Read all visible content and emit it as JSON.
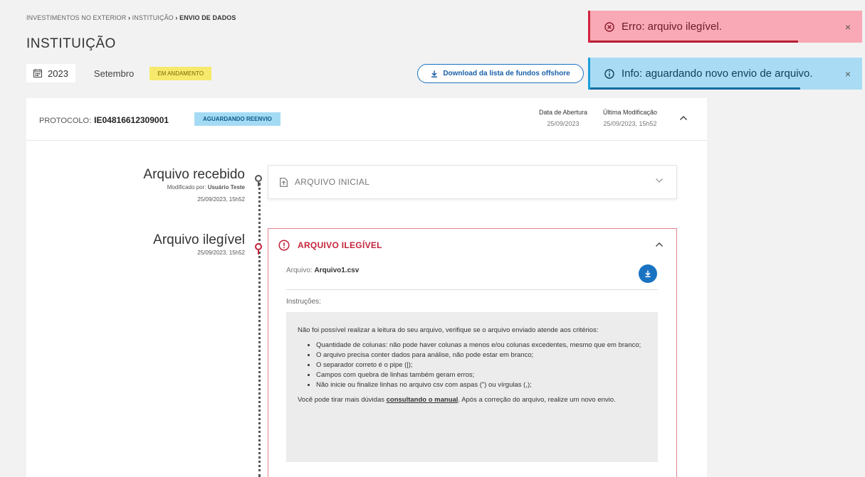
{
  "breadcrumb": {
    "part1": "INVESTIMENTOS NO EXTERIOR",
    "sep1": " › ",
    "part2": "INSTITUIÇÃO",
    "sep2": " › ",
    "part3": "ENVIO DE DADOS"
  },
  "page_title": "INSTITUIÇÃO",
  "meta": {
    "year": "2023",
    "month": "Setembro",
    "status": "EM ANDAMENTO"
  },
  "download_button": "Download da lista de fundos offshore",
  "toasts": {
    "error": {
      "text": "Erro: arquivo ilegível.",
      "close": "×"
    },
    "info": {
      "text": "Info: aguardando novo envio de arquivo.",
      "close": "×"
    }
  },
  "protocol": {
    "label": "PROTOCOLO:",
    "value": "IE04816612309001",
    "status": "AGUARDANDO REENVIO",
    "opening_label": "Data de Abertura",
    "opening_value": "25/09/2023",
    "modified_label": "Última Modificação",
    "modified_value": "25/09/2023, 15h52"
  },
  "timeline": [
    {
      "title": "Arquivo recebido",
      "modified_by_label": "Modificado por:",
      "modified_by": "Usuário Teste",
      "date": "25/09/2023, 15h52",
      "panel_title": "ARQUIVO INICIAL"
    },
    {
      "title": "Arquivo ilegível",
      "date": "25/09/2023, 15h52",
      "panel_title": "ARQUIVO ILEGÍVEL",
      "file_label": "Arquivo:",
      "file_name": "Arquivo1.csv",
      "instructions_label": "Instruções:",
      "intro": "Não foi possível realizar a leitura do seu arquivo, verifique se o arquivo enviado atende aos critérios:",
      "criteria": [
        "Quantidade de colunas: não pode haver colunas a menos e/ou colunas excedentes, mesmo que em branco;",
        "O arquivo precisa conter dados para análise, não pode estar em branco;",
        "O separador correto é o pipe (|);",
        "Campos com quebra de linhas também geram erros;",
        "Não inicie ou finalize linhas no arquivo csv com aspas (\") ou vírgulas (,);"
      ],
      "footer_before": "Você pode tirar mais dúvidas ",
      "footer_link": "consultando o manual",
      "footer_after": ". Após a correção do arquivo, realize um novo envio."
    }
  ],
  "colors": {
    "error": "#c3233b",
    "info": "#1aa0db",
    "primary": "#1a73c1",
    "warning_badge": "#f6e96b"
  },
  "icons": [
    "calendar-icon",
    "download-icon",
    "error-circle-icon",
    "info-circle-icon",
    "close-icon",
    "chevron-up-icon",
    "chevron-down-icon",
    "file-upload-icon",
    "alert-circle-icon"
  ]
}
